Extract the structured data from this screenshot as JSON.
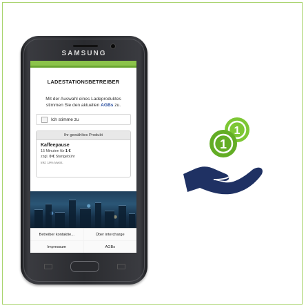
{
  "phone": {
    "brand": "SAMSUNG"
  },
  "app": {
    "title": "LADESTATIONSBETREIBER",
    "info_text_1": "Mit der Auswahl eines Ladeproduktes",
    "info_text_2": "stimmen Sie den aktuellen ",
    "info_agb": "AGBs",
    "info_text_3": " zu.",
    "agree_label": "Ich stimme zu",
    "product_header": "Ihr gewähltes Produkt",
    "product_name": "Kaffeepause",
    "product_line1_prefix": "15 Minuten für ",
    "product_line1_value": "1 €",
    "product_line2_prefix": "zzgl. ",
    "product_line2_value": "0 €",
    "product_line2_suffix": " Startgebühr",
    "product_note": "inkl. 19% MwSt.",
    "footer_buttons": [
      "Betreiber kontaktie...",
      "Über intercharge",
      "Impressum",
      "AGBs"
    ]
  },
  "colors": {
    "accent_green": "#8bc34a",
    "hand_navy": "#1f3163",
    "coin_green": "#6fba2c"
  },
  "icons": {
    "hand": "hand-with-coins-icon"
  }
}
